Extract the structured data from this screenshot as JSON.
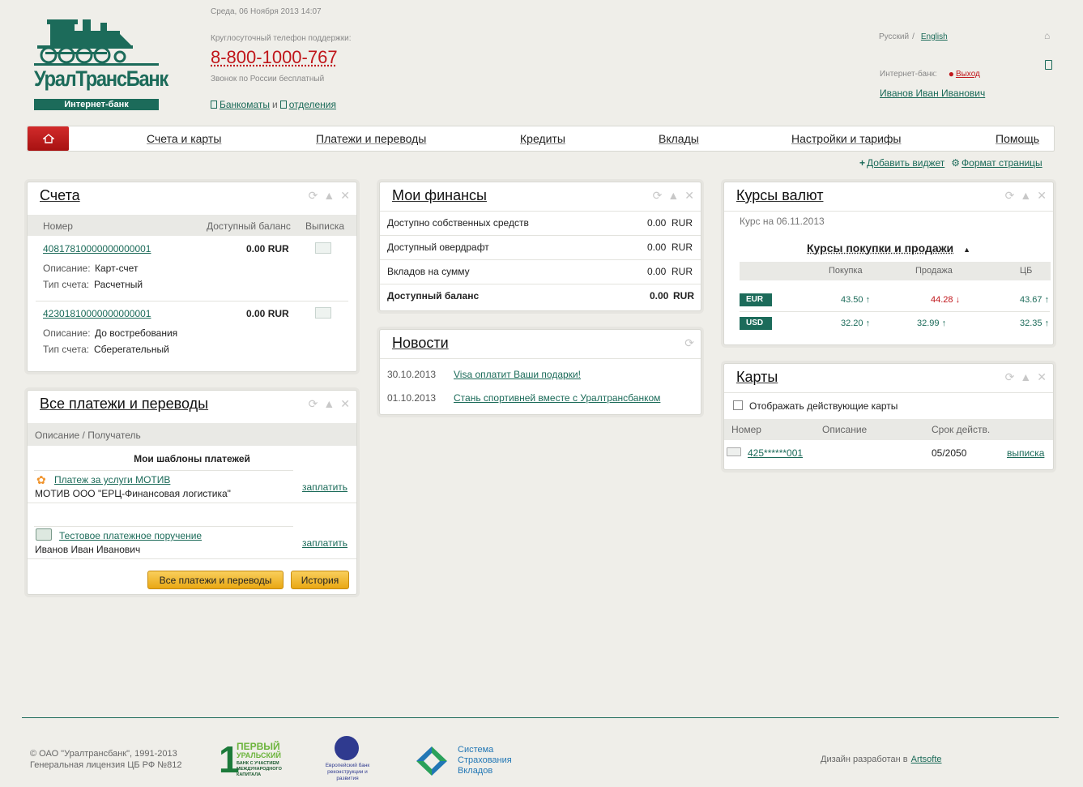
{
  "header": {
    "logo_text": "УралТрансБанк",
    "logo_sub": "Интернет-банк",
    "datetime": "Среда, 06 Ноября 2013 14:07",
    "support_label": "Круглосуточный телефон поддержки:",
    "phone": "8-800-1000-767",
    "phone_note": "Звонок по России бесплатный",
    "atm_link": "Банкоматы",
    "and": "и",
    "branches_link": "отделения",
    "lang_ru": "Русский",
    "lang_sep": "/",
    "lang_en": "English",
    "ibank_label": "Интернет-банк:",
    "logout": "Выход",
    "user_name": "Иванов Иван Иванович"
  },
  "nav": {
    "items": [
      "Счета и карты",
      "Платежи и переводы",
      "Кредиты",
      "Вклады",
      "Настройки и тарифы",
      "Помощь"
    ]
  },
  "toolbar": {
    "add_widget": "Добавить виджет",
    "page_format": "Формат страницы"
  },
  "accounts": {
    "title": "Счета",
    "col_number": "Номер",
    "col_balance": "Доступный баланс",
    "col_statement": "Выписка",
    "rows": [
      {
        "number": "40817810000000000001",
        "balance": "0.00 RUR",
        "desc_label": "Описание:",
        "desc": "Карт-счет",
        "type_label": "Тип счета:",
        "type": "Расчетный"
      },
      {
        "number": "42301810000000000001",
        "balance": "0.00 RUR",
        "desc_label": "Описание:",
        "desc": "До востребования",
        "type_label": "Тип счета:",
        "type": "Сберегательный"
      }
    ]
  },
  "payments": {
    "title": "Все платежи и переводы",
    "col_desc": "Описание / Получатель",
    "templates_title": "Мои шаблоны платежей",
    "items": [
      {
        "name": "Платеж за услуги МОТИВ",
        "recipient": "МОТИВ ООО \"ЕРЦ-Финансовая логистика\"",
        "action": "заплатить"
      },
      {
        "name": "Тестовое платежное поручение",
        "recipient": "Иванов Иван Иванович",
        "action": "заплатить"
      }
    ],
    "all_button": "Все платежи и переводы",
    "history_button": "История"
  },
  "finances": {
    "title": "Мои финансы",
    "rows": [
      {
        "label": "Доступно собственных средств",
        "value": "0.00",
        "cur": "RUR"
      },
      {
        "label": "Доступный овердрафт",
        "value": "0.00",
        "cur": "RUR"
      },
      {
        "label": "Вкладов на сумму",
        "value": "0.00",
        "cur": "RUR"
      },
      {
        "label": "Доступный баланс",
        "value": "0.00",
        "cur": "RUR"
      }
    ]
  },
  "news": {
    "title": "Новости",
    "items": [
      {
        "date": "30.10.2013",
        "text": "Visa оплатит Ваши подарки!"
      },
      {
        "date": "01.10.2013",
        "text": "Стань спортивней вместе с Уралтрансбанком"
      }
    ]
  },
  "rates": {
    "title": "Курсы валют",
    "date": "Курс на 06.11.2013",
    "subtitle": "Курсы покупки и продажи",
    "col_buy": "Покупка",
    "col_sell": "Продажа",
    "col_cb": "ЦБ",
    "rows": [
      {
        "cur": "EUR",
        "buy": "43.50",
        "sell": "44.28",
        "cb": "43.67"
      },
      {
        "cur": "USD",
        "buy": "32.20",
        "sell": "32.99",
        "cb": "32.35"
      }
    ]
  },
  "cards": {
    "title": "Карты",
    "show_active": "Отображать действующие карты",
    "col_number": "Номер",
    "col_desc": "Описание",
    "col_expiry": "Срок действ.",
    "rows": [
      {
        "number": "425******001",
        "desc": "",
        "expiry": "05/2050",
        "action": "выписка"
      }
    ]
  },
  "footer": {
    "copyright": "© ОАО \"Уралтрансбанк\", 1991-2013",
    "license": "Генеральная лицензия ЦБ РФ №812",
    "partner1_big": "ПЕРВЫЙ",
    "partner1_sub": "УРАЛЬСКИЙ",
    "partner1_small": "БАНК С УЧАСТИЕМ МЕЖДУНАРОДНОГО КАПИТАЛА",
    "partner2": "Европейский банк реконструкции и развития",
    "partner3_l1": "Система",
    "partner3_l2": "Страхования",
    "partner3_l3": "Вкладов",
    "design_label": "Дизайн разработан в",
    "design_link": "Artsofte"
  },
  "colors": {
    "brand_green": "#1c6b5a",
    "accent_red": "#c0161b",
    "button_yellow": "#f2bb35"
  }
}
